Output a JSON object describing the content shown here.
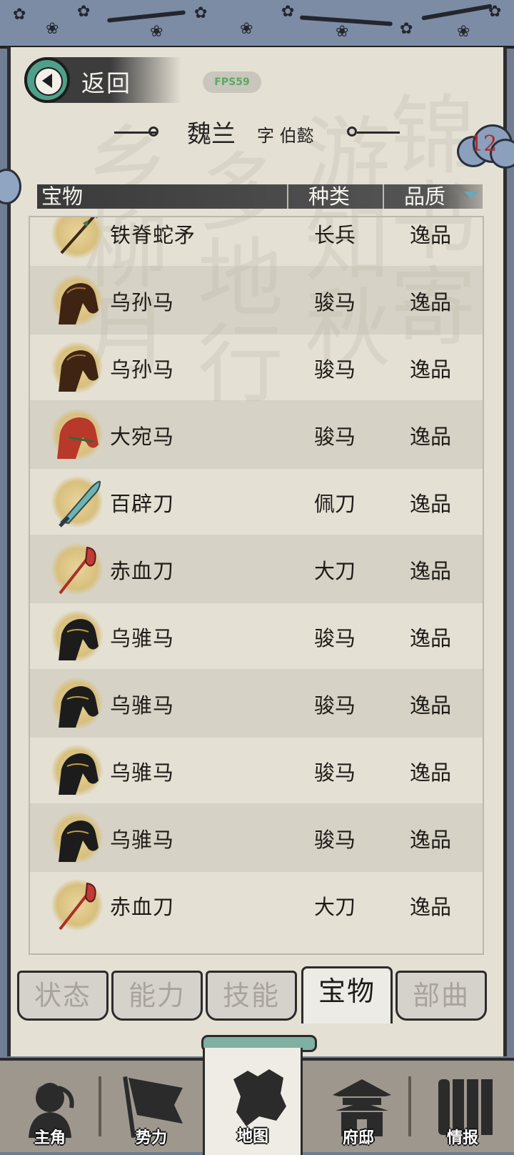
{
  "header": {
    "back_label": "返回",
    "fps_badge": "FPS59",
    "title_name": "魏兰",
    "title_courtesy": "字 伯懿",
    "cloud_count": "12"
  },
  "table": {
    "columns": [
      "宝物",
      "种类",
      "品质"
    ],
    "sort_column": "品质",
    "rows": [
      {
        "name": "铁脊蛇矛",
        "kind": "长兵",
        "quality": "逸品",
        "icon": "spear-icon"
      },
      {
        "name": "乌孙马",
        "kind": "骏马",
        "quality": "逸品",
        "icon": "brown-horse-icon"
      },
      {
        "name": "乌孙马",
        "kind": "骏马",
        "quality": "逸品",
        "icon": "brown-horse-icon"
      },
      {
        "name": "大宛马",
        "kind": "骏马",
        "quality": "逸品",
        "icon": "red-horse-icon"
      },
      {
        "name": "百辟刀",
        "kind": "佩刀",
        "quality": "逸品",
        "icon": "sword-icon"
      },
      {
        "name": "赤血刀",
        "kind": "大刀",
        "quality": "逸品",
        "icon": "glaive-icon"
      },
      {
        "name": "乌骓马",
        "kind": "骏马",
        "quality": "逸品",
        "icon": "black-horse-icon"
      },
      {
        "name": "乌骓马",
        "kind": "骏马",
        "quality": "逸品",
        "icon": "black-horse-icon"
      },
      {
        "name": "乌骓马",
        "kind": "骏马",
        "quality": "逸品",
        "icon": "black-horse-icon"
      },
      {
        "name": "乌骓马",
        "kind": "骏马",
        "quality": "逸品",
        "icon": "black-horse-icon"
      },
      {
        "name": "赤血刀",
        "kind": "大刀",
        "quality": "逸品",
        "icon": "glaive-icon"
      }
    ]
  },
  "tabs": [
    {
      "label": "状态",
      "active": false
    },
    {
      "label": "能力",
      "active": false
    },
    {
      "label": "技能",
      "active": false
    },
    {
      "label": "宝物",
      "active": true
    },
    {
      "label": "部曲",
      "active": false
    }
  ],
  "nav": [
    {
      "label": "主角",
      "icon": "general-icon",
      "active": false
    },
    {
      "label": "势力",
      "icon": "flag-icon",
      "active": false
    },
    {
      "label": "地图",
      "icon": "map-icon",
      "active": true
    },
    {
      "label": "府邸",
      "icon": "mansion-icon",
      "active": false
    },
    {
      "label": "情报",
      "icon": "scroll-icon",
      "active": false
    }
  ],
  "colors": {
    "paper": "#e4e0d4",
    "back_button": "#4fa089",
    "badge_number": "#b12a2a",
    "fps_text": "#5aaa60",
    "banner": "#7d8ca5"
  }
}
